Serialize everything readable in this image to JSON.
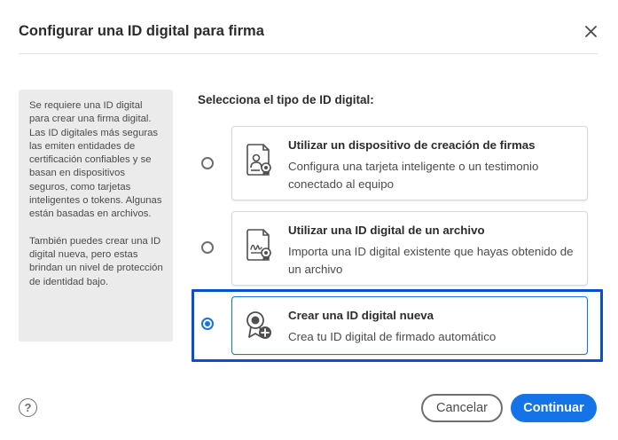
{
  "dialog": {
    "title": "Configurar una ID digital para firma",
    "close_icon": "close-icon"
  },
  "info_panel": {
    "paragraph1": "Se requiere una ID digital para crear una firma digital. Las ID digitales más seguras las emiten entidades de certificación confiables y se basan en dispositivos seguros, como tarjetas inteligentes o tokens. Algunas están basadas en archivos.",
    "paragraph2": "También puedes crear una ID digital nueva, pero estas brindan un nivel de protección de identidad bajo."
  },
  "select_label": "Selecciona el tipo de ID digital:",
  "options": [
    {
      "title": "Utilizar un dispositivo de creación de firmas",
      "description": "Configura una tarjeta inteligente o un testimonio conectado al equipo",
      "icon": "smartcard-certificate-icon",
      "selected": false
    },
    {
      "title": "Utilizar una ID digital de un archivo",
      "description": "Importa una ID digital existente que hayas obtenido de un archivo",
      "icon": "signature-file-icon",
      "selected": false
    },
    {
      "title": "Crear una ID digital nueva",
      "description": "Crea tu ID digital de firmado automático",
      "icon": "badge-add-icon",
      "selected": true
    }
  ],
  "footer": {
    "help_label": "?",
    "cancel_label": "Cancelar",
    "continue_label": "Continuar"
  },
  "colors": {
    "accent": "#1473e6",
    "highlight_frame": "#0b4fd1",
    "info_panel_bg": "#ebebeb"
  }
}
